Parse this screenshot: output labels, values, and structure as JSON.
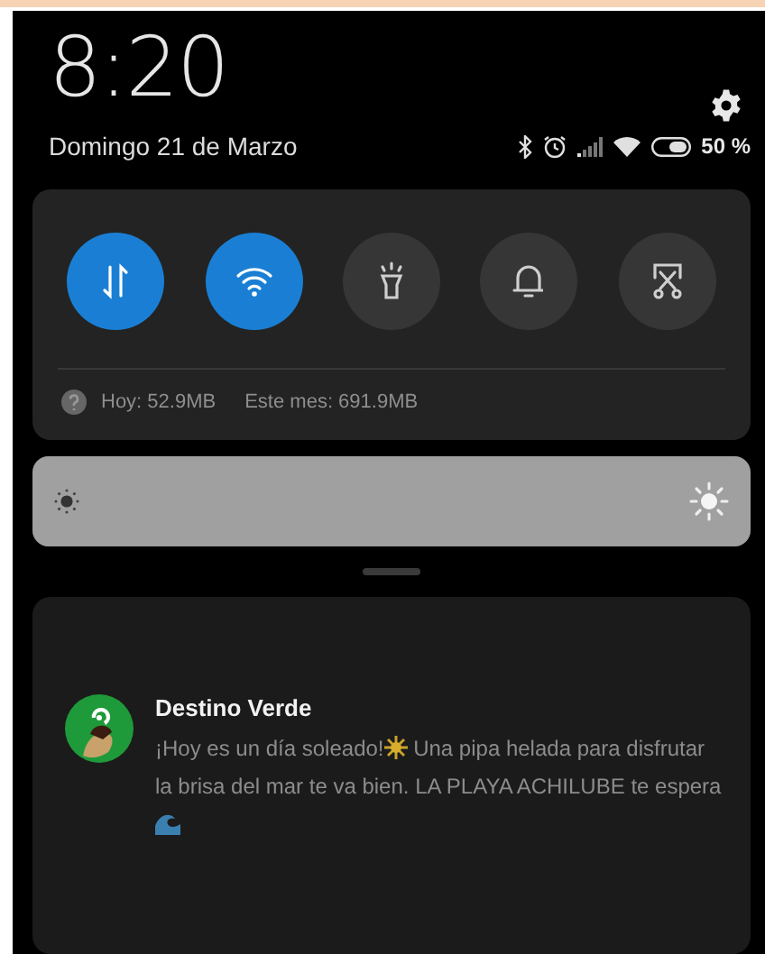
{
  "header": {
    "time": "8:20",
    "date": "Domingo 21 de Marzo",
    "battery": "50 %"
  },
  "toggles": [
    {
      "kind": "data",
      "on": true
    },
    {
      "kind": "wifi",
      "on": true
    },
    {
      "kind": "flashlight",
      "on": false
    },
    {
      "kind": "bell",
      "on": false
    },
    {
      "kind": "screenshot",
      "on": false
    }
  ],
  "usage": {
    "today": "Hoy: 52.9MB",
    "month": "Este mes: 691.9MB"
  },
  "brightness": {
    "level": 1
  },
  "notification": {
    "app": "Destino Verde",
    "parts": [
      {
        "kind": "text",
        "text": "¡Hoy es un día soleado!"
      },
      {
        "kind": "sun"
      },
      {
        "kind": "text",
        "text": " Una pipa helada para disfrutar la brisa del mar te va bien. LA PLAYA ACHILUBE te espera "
      },
      {
        "kind": "wave"
      }
    ]
  }
}
